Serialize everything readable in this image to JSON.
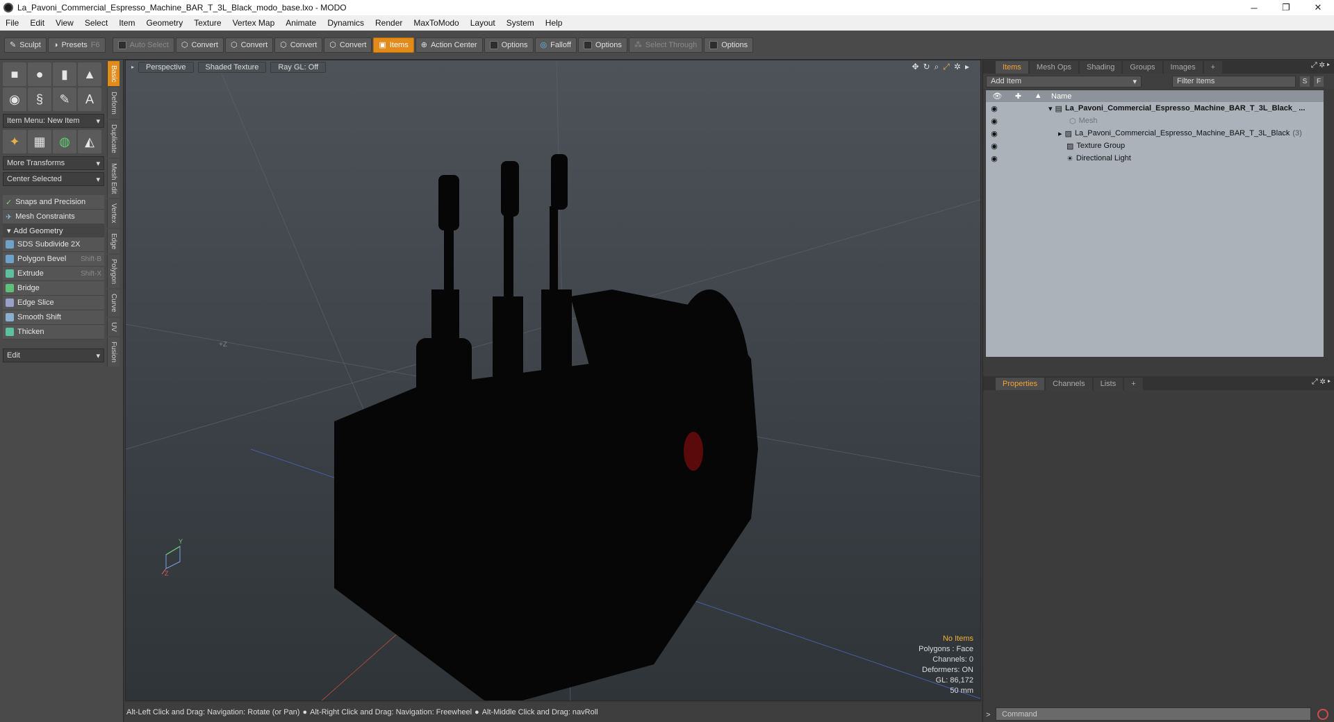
{
  "window": {
    "title": "La_Pavoni_Commercial_Espresso_Machine_BAR_T_3L_Black_modo_base.lxo - MODO",
    "minimize": "─",
    "maximize": "❐",
    "close": "✕"
  },
  "menu": [
    "File",
    "Edit",
    "View",
    "Select",
    "Item",
    "Geometry",
    "Texture",
    "Vertex Map",
    "Animate",
    "Dynamics",
    "Render",
    "MaxToModo",
    "Layout",
    "System",
    "Help"
  ],
  "toolbar": {
    "sculpt": "Sculpt",
    "presets": "Presets",
    "presets_key": "F6",
    "auto_select": "Auto Select",
    "convert1": "Convert",
    "convert2": "Convert",
    "convert3": "Convert",
    "convert4": "Convert",
    "items": "Items",
    "action_center": "Action Center",
    "options1": "Options",
    "falloff": "Falloff",
    "options2": "Options",
    "select_through": "Select Through",
    "options3": "Options"
  },
  "left": {
    "item_menu": "Item Menu: New Item",
    "more_transforms": "More Transforms",
    "center_selected": "Center Selected",
    "snaps": "Snaps and Precision",
    "mesh_constraints": "Mesh Constraints",
    "add_geometry": "Add Geometry",
    "tools": [
      {
        "label": "SDS Subdivide 2X",
        "key": ""
      },
      {
        "label": "Polygon Bevel",
        "key": "Shift-B"
      },
      {
        "label": "Extrude",
        "key": "Shift-X"
      },
      {
        "label": "Bridge",
        "key": ""
      },
      {
        "label": "Edge Slice",
        "key": ""
      },
      {
        "label": "Smooth Shift",
        "key": ""
      },
      {
        "label": "Thicken",
        "key": ""
      }
    ],
    "edit": "Edit",
    "vtabs": [
      "Basic",
      "Deform",
      "Duplicate",
      "Mesh Edit",
      "Vertex",
      "Edge",
      "Polygon",
      "Curve",
      "UV",
      "Fusion"
    ]
  },
  "viewport": {
    "perspective": "Perspective",
    "shaded": "Shaded Texture",
    "raygl": "Ray GL: Off",
    "stats": {
      "no_items": "No Items",
      "polygons": "Polygons : Face",
      "channels": "Channels: 0",
      "deformers": "Deformers: ON",
      "gl": "GL: 86,172",
      "size": "50 mm"
    },
    "axis_z": "+Z",
    "axis_y": "Y",
    "axis_x": "X",
    "axis_z2": "Z"
  },
  "statusbar": {
    "hint1": "Alt-Left Click and Drag: Navigation: Rotate (or Pan)",
    "hint2": "Alt-Right Click and Drag: Navigation: Freewheel",
    "hint3": "Alt-Middle Click and Drag: navRoll"
  },
  "right": {
    "tabs": [
      "Items",
      "Mesh Ops",
      "Shading",
      "Groups",
      "Images"
    ],
    "add_tab": "+",
    "add_item": "Add Item",
    "filter": "Filter Items",
    "s_btn": "S",
    "f_btn": "F",
    "col_name": "Name",
    "items": [
      {
        "name": "La_Pavoni_Commercial_Espresso_Machine_BAR_T_3L_Black_ ...",
        "count": ""
      },
      {
        "name": "Mesh",
        "count": ""
      },
      {
        "name": "La_Pavoni_Commercial_Espresso_Machine_BAR_T_3L_Black",
        "count": "(3)"
      },
      {
        "name": "Texture Group",
        "count": ""
      },
      {
        "name": "Directional Light",
        "count": ""
      }
    ],
    "props_tabs": [
      "Properties",
      "Channels",
      "Lists"
    ],
    "command": "Command"
  }
}
